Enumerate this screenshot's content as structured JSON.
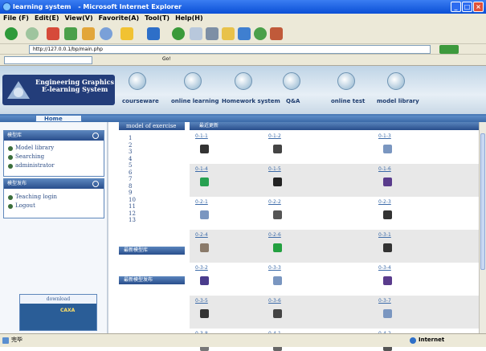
{
  "window": {
    "title_prefix": "learning system",
    "title_app": "- Microsoft Internet Explorer"
  },
  "menubar": [
    "File (F)",
    "Edit(E)",
    "View(V)",
    "Favorite(A)",
    "Tool(T)",
    "Help(H)"
  ],
  "address": {
    "url": "http://127.0.0.1/bp/main.php"
  },
  "links_bar": {
    "go_label": "Go!"
  },
  "site": {
    "title_line1": "Engineering Graphics",
    "title_line2": "E-learning System"
  },
  "nav": [
    "courseware",
    "online learning",
    "Homework system",
    "Q&A",
    "online test",
    "model library"
  ],
  "subnav": {
    "home": "Home"
  },
  "sidebar": {
    "panel1": {
      "title": "模型库",
      "items": [
        "Model library",
        "Searching",
        "administrator"
      ]
    },
    "panel2": {
      "title": "模型发布",
      "items": [
        "Teaching login",
        "Logout"
      ]
    },
    "download": "download",
    "caxa": "CAXA"
  },
  "exercises": {
    "header": "model of exercise",
    "numbers": [
      "1",
      "2",
      "3",
      "4",
      "5",
      "6",
      "7",
      "8",
      "9",
      "10",
      "11",
      "12",
      "13"
    ],
    "btn1": "最新模型库",
    "btn2": "最新模型发布"
  },
  "grid": {
    "header": "最近更新",
    "rows": [
      [
        "0-1-1",
        "0-1-2",
        "0-1-3"
      ],
      [
        "0-1-4",
        "0-1-5",
        "0-1-6"
      ],
      [
        "0-2-1",
        "0-2-2",
        "0-2-3"
      ],
      [
        "0-2-4",
        "0-2-6",
        "0-3-1"
      ],
      [
        "0-3-2",
        "0-3-3",
        "0-3-4"
      ],
      [
        "0-3-5",
        "0-3-6",
        "0-3-7"
      ],
      [
        "0-3-8",
        "0-4-1",
        "0-4-2"
      ]
    ]
  },
  "status": {
    "left": "完毕",
    "right": "Internet"
  },
  "colors": {
    "accent": "#294e8c",
    "title_bar": "#0a4fd6",
    "chrome": "#ece9d8"
  }
}
